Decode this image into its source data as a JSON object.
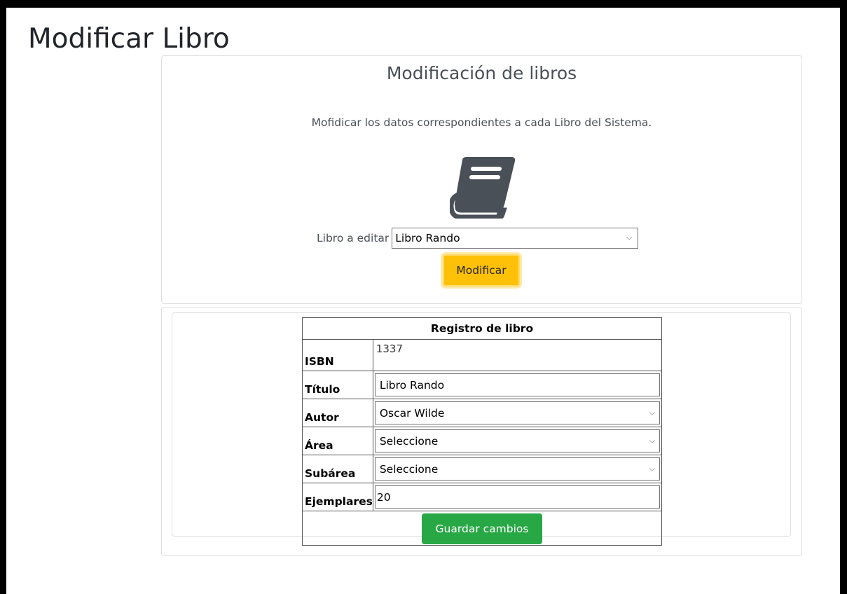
{
  "page": {
    "title": "Modificar Libro"
  },
  "top_card": {
    "title": "Modificación de libros",
    "description": "Mofidicar los datos correspondientes a cada Libro del Sistema.",
    "icon": "book-icon",
    "select_label": "Libro a editar",
    "select_value": "Libro Rando",
    "button_label": "Modificar"
  },
  "form": {
    "header": "Registro de libro",
    "isbn_label": "ISBN",
    "isbn_value": "1337",
    "titulo_label": "Título",
    "titulo_value": "Libro Rando",
    "autor_label": "Autor",
    "autor_value": "Oscar Wilde",
    "area_label": "Área",
    "area_value": "Seleccione",
    "subarea_label": "Subárea",
    "subarea_value": "Seleccione",
    "ejemplares_label": "Ejemplares",
    "ejemplares_value": "20",
    "save_label": "Guardar cambios"
  },
  "colors": {
    "warning": "#ffc107",
    "success": "#28a745",
    "icon": "#495057"
  }
}
